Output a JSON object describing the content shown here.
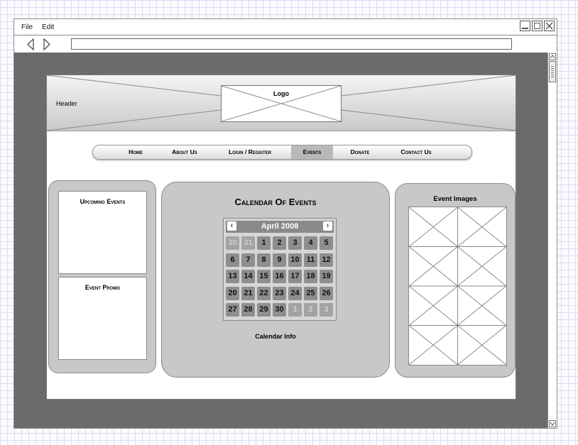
{
  "menubar": {
    "file_label": "File",
    "edit_label": "Edit"
  },
  "page": {
    "header": {
      "label": "Header",
      "logo_label": "Logo"
    },
    "nav": {
      "items": [
        {
          "label": "Home"
        },
        {
          "label": "About Us"
        },
        {
          "label": "Login / Register"
        },
        {
          "label": "Events",
          "active": true
        },
        {
          "label": "Donate"
        },
        {
          "label": "Contact Us"
        }
      ]
    },
    "left_panel": {
      "upcoming_title": "Upcoming Events",
      "promo_title": "Event Promo"
    },
    "center_panel": {
      "title": "Calendar Of Events",
      "info": "Calendar Info",
      "calendar": {
        "month": "April 2008",
        "prev_icon": "chevron-left-icon",
        "next_icon": "chevron-right-icon",
        "weeks": [
          [
            {
              "d": "30",
              "o": true
            },
            {
              "d": "31",
              "o": true
            },
            {
              "d": "1"
            },
            {
              "d": "2"
            },
            {
              "d": "3"
            },
            {
              "d": "4"
            },
            {
              "d": "5"
            }
          ],
          [
            {
              "d": "6"
            },
            {
              "d": "7"
            },
            {
              "d": "8"
            },
            {
              "d": "9"
            },
            {
              "d": "10"
            },
            {
              "d": "11"
            },
            {
              "d": "12"
            }
          ],
          [
            {
              "d": "13"
            },
            {
              "d": "14"
            },
            {
              "d": "15"
            },
            {
              "d": "16"
            },
            {
              "d": "17"
            },
            {
              "d": "18"
            },
            {
              "d": "19"
            }
          ],
          [
            {
              "d": "20"
            },
            {
              "d": "21"
            },
            {
              "d": "22"
            },
            {
              "d": "23"
            },
            {
              "d": "24"
            },
            {
              "d": "25"
            },
            {
              "d": "26"
            }
          ],
          [
            {
              "d": "27"
            },
            {
              "d": "28"
            },
            {
              "d": "29"
            },
            {
              "d": "30"
            },
            {
              "d": "1",
              "o": true
            },
            {
              "d": "2",
              "o": true
            },
            {
              "d": "3",
              "o": true
            }
          ]
        ]
      }
    },
    "right_panel": {
      "title": "Event Images"
    }
  },
  "icons": {
    "back": "back-arrow-icon",
    "forward": "forward-arrow-icon",
    "minimize": "minimize-icon",
    "maximize": "maximize-icon",
    "close": "close-icon"
  }
}
